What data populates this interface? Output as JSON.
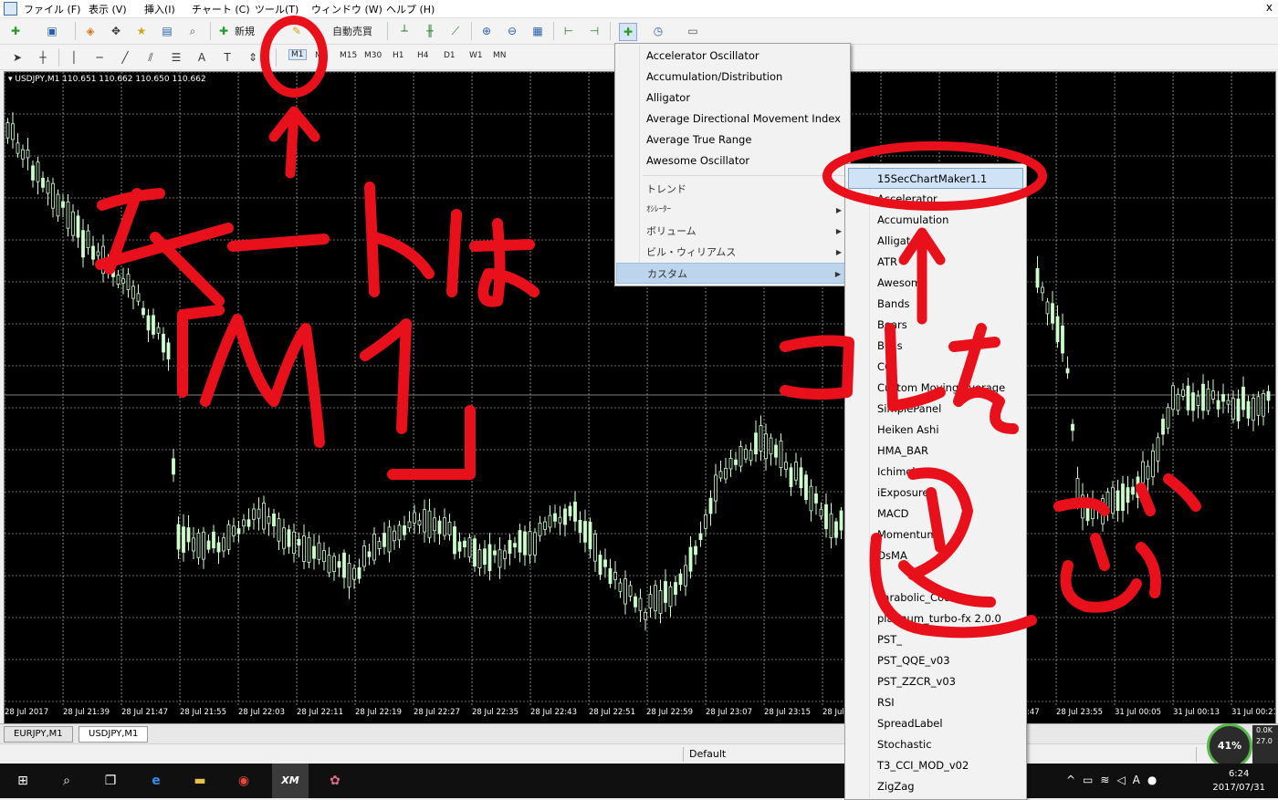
{
  "menubar": {
    "items": [
      "ファイル (F)",
      "表示 (V)",
      "挿入(I)",
      "チャート (C)",
      "ツール(T)",
      "ウィンドウ (W)",
      "ヘルプ (H)"
    ],
    "close": "x"
  },
  "toolbar1": {
    "new_order": "新規",
    "auto_trade": "自動売買"
  },
  "toolbar2": {
    "timeframes": [
      "M1",
      "M5",
      "M15",
      "M30",
      "H1",
      "H4",
      "D1",
      "W1",
      "MN"
    ],
    "active_timeframe": "M1"
  },
  "chart": {
    "title": "▾ USDJPY,M1  110.651 110.662 110.650 110.662",
    "background": "#000000",
    "candle_color": "#ccffcc",
    "date_labels": [
      "28 Jul 2017",
      "28 Jul 21:39",
      "28 Jul 21:47",
      "28 Jul 21:55",
      "28 Jul 22:03",
      "28 Jul 22:11",
      "28 Jul 22:19",
      "28 Jul 22:27",
      "28 Jul 22:35",
      "28 Jul 22:43",
      "28 Jul 22:51",
      "28 Jul 22:59",
      "28 Jul 23:07",
      "28 Jul 23:15",
      "28 Jul",
      ":47",
      "28 Jul 23:55",
      "31 Jul 00:05",
      "31 Jul 00:13",
      "31 Jul 00:21"
    ]
  },
  "tabs": [
    {
      "label": "EURJPY,M1"
    },
    {
      "label": "USDJPY,M1"
    }
  ],
  "status": {
    "profile": "Default"
  },
  "gauge": {
    "percent": "41%",
    "net_top": "0.0K",
    "net_bottom": "27.0"
  },
  "taskbar": {
    "time": "6:24",
    "date": "2017/07/31",
    "xm_label": "XM"
  },
  "indicator_menu": {
    "items": [
      {
        "label": "Accelerator Oscillator"
      },
      {
        "label": "Accumulation/Distribution"
      },
      {
        "label": "Alligator"
      },
      {
        "label": "Average Directional Movement Index"
      },
      {
        "label": "Average True Range"
      },
      {
        "label": "Awesome Oscillator"
      }
    ],
    "groups": [
      {
        "label": "トレンド"
      },
      {
        "label": "ｵｼﾚｰﾀｰ"
      },
      {
        "label": "ボリューム"
      },
      {
        "label": "ビル・ウィリアムス"
      },
      {
        "label": "カスタム"
      }
    ]
  },
  "custom_menu": {
    "items": [
      "15SecChartMaker1.1",
      "Accelerator",
      "Accumulation",
      "Alligator",
      "ATR",
      "Awesome",
      "Bands",
      "Bears",
      "Bulls",
      "CCI",
      "Custom Moving Average",
      "SimplePanel",
      "Heiken Ashi",
      "HMA_BAR",
      "Ichimoku",
      "iExposure",
      "MACD",
      "Momentum",
      "OsMA",
      "",
      "Parabolic_Counter_",
      "platinum_turbo-fx 2.0.0",
      "PST_",
      "PST_QQE_v03",
      "PST_ZZCR_v03",
      "RSI",
      "SpreadLabel",
      "Stochastic",
      "T3_CCI_MOD_v02",
      "ZigZag"
    ]
  },
  "annotations": {
    "color": "#e8101a"
  }
}
